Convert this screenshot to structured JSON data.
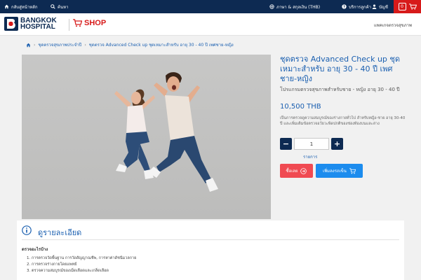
{
  "topbar": {
    "home_label": "กลับสู่หน้าหลัก",
    "search_label": "ค้นหา",
    "language_currency": "ภาษา & สกุลเงิน (THB)",
    "customer_service": "บริการลูกค้า",
    "account": "บัญชี",
    "cart_count": "0"
  },
  "header": {
    "logo_line1": "BANGKOK",
    "logo_line2": "HOSPITAL",
    "shop_label": "SHOP",
    "nav_link": "แพคเกจตรวจสุขภาพ"
  },
  "breadcrumb": {
    "items": [
      "ชุดตรวจสุขภาพประจำปี",
      "ชุดตรวจ Advanced Check up ชุดเหมาะสำหรับ อายุ 30 - 40 ปี เพศชาย-หญิง"
    ]
  },
  "product": {
    "title": "ชุดตรวจ Advanced Check up ชุดเหมาะสำหรับ อายุ 30 - 40 ปี เพศชาย-หญิง",
    "subtitle": "โปรแกรมตรวจสุขภาพสำหรับชาย - หญิง อายุ 30 - 40 ปี",
    "price": "10,500 THB",
    "description": "เป็นการตรวจดูความสมบูรณ์ของร่างกายทั่วไป สำหรับหญิง-ชาย อายุ 30-40 ปี และเพิ่มเติมข้อตรวจอวัยวะพิดปกติของช่องท้องบนและล่าง",
    "quantity": "1",
    "quantity_label": "รายการ",
    "more_button": "ซื้อเลย",
    "cart_button": "เพิ่มลงรถเข็น"
  },
  "details": {
    "title": "ดูรายละเอียด",
    "subtitle": "ตรวจอะไรบ้าง",
    "items": [
      "1. การตรวจวัดพื้นฐาน การวัดสัญญาณชีพ, การหาค่าดัชนีมวลกาย",
      "2. การตรวจร่างกายโดยแพทย์",
      "3. ตรวจความสมบูรณ์ของเม็ดเลือดและเกล็ดเลือด"
    ]
  },
  "colors": {
    "navy": "#0d2a52",
    "brand_red": "#d71a1a",
    "link_blue": "#1a5fb0",
    "buy_button": "#f04a52",
    "cart_button": "#1c8cee"
  },
  "icons": [
    "home-icon",
    "search-icon",
    "globe-icon",
    "help-icon",
    "user-icon",
    "cart-icon",
    "info-icon",
    "arrow-right-icon",
    "add-cart-icon"
  ]
}
